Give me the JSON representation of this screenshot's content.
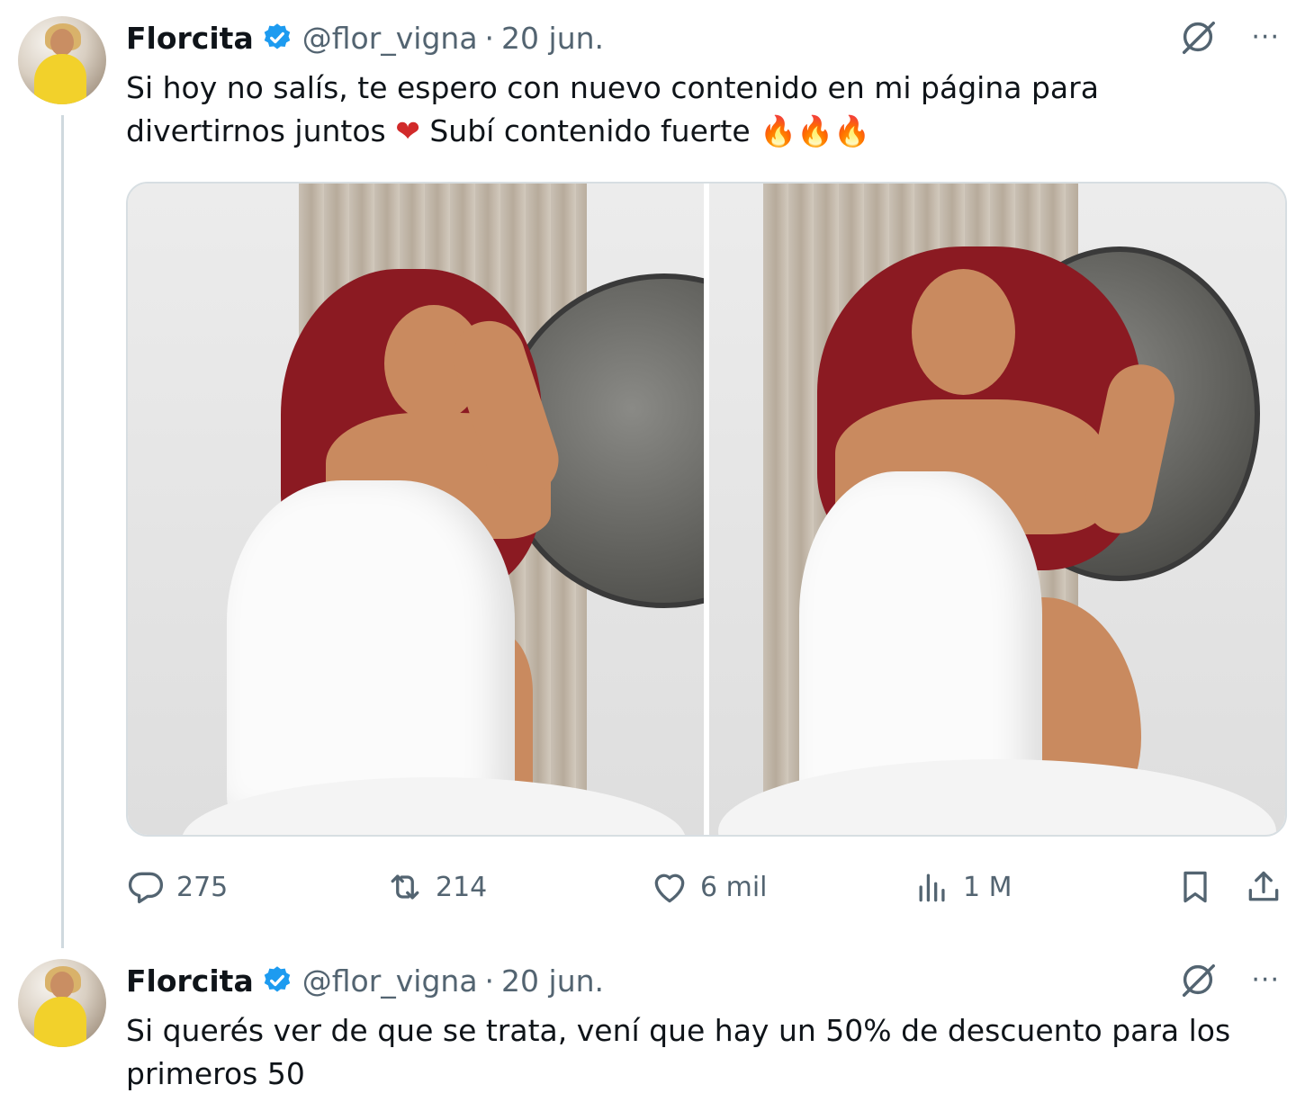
{
  "tweets": [
    {
      "name": "Florcita",
      "handle": "@flor_vigna",
      "separator": "·",
      "date": "20 jun.",
      "text_line1": "Si hoy no salís, te espero con nuevo contenido en mi página para",
      "text_line2_a": "divertirnos juntos ",
      "heart": "❤",
      "text_line2_b": " Subí contenido fuerte ",
      "fires": "🔥🔥🔥",
      "stats": {
        "replies": "275",
        "reposts": "214",
        "likes": "6 mil",
        "views": "1 M"
      },
      "more_label": "···"
    },
    {
      "name": "Florcita",
      "handle": "@flor_vigna",
      "separator": "·",
      "date": "20 jun.",
      "text": "Si querés ver de que se trata, vení que hay un 50% de descuento para los primeros 50",
      "more_label": "···"
    }
  ],
  "colors": {
    "verified": "#1d9bf0",
    "muted": "#536471",
    "text": "#0f1419",
    "thread_line": "#cfd9de"
  }
}
